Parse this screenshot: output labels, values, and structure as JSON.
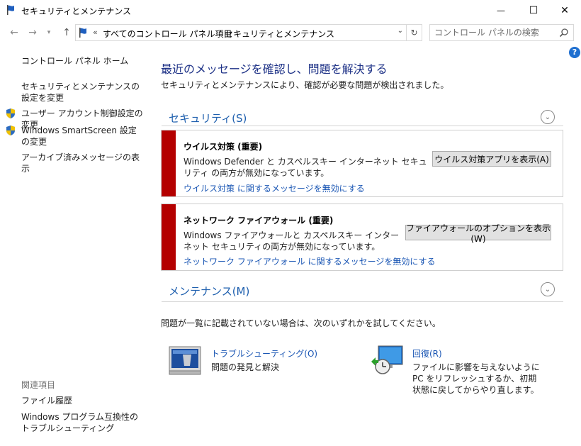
{
  "window": {
    "title": "セキュリティとメンテナンス",
    "minimize_glyph": "—",
    "maximize_glyph": "☐",
    "close_glyph": "✕"
  },
  "navigation": {
    "back_glyph": "←",
    "forward_glyph": "→",
    "recent_glyph": "▾",
    "up_glyph": "↑",
    "address_overflow": "«",
    "breadcrumbs": [
      "すべてのコントロール パネル項目",
      "セキュリティとメンテナンス"
    ],
    "separator": "›",
    "dropdown_glyph": "⌄",
    "refresh_glyph": "↻",
    "search_placeholder": "コントロール パネルの検索"
  },
  "help_glyph": "?",
  "sidebar": {
    "home": "コントロール パネル ホーム",
    "items": [
      {
        "label": "セキュリティとメンテナンスの設定を変更",
        "shield": false
      },
      {
        "label": "ユーザー アカウント制御設定の変更",
        "shield": true
      },
      {
        "label": "Windows SmartScreen 設定の変更",
        "shield": true
      },
      {
        "label": "アーカイブ済みメッセージの表示",
        "shield": false
      }
    ],
    "related_heading": "関連項目",
    "related": [
      "ファイル履歴",
      "Windows プログラム互換性のトラブルシューティング"
    ]
  },
  "main": {
    "heading": "最近のメッセージを確認し、問題を解決する",
    "subtext": "セキュリティとメンテナンスにより、確認が必要な問題が検出されました。",
    "security": {
      "title": "セキュリティ(S)",
      "alerts": [
        {
          "title": "ウイルス対策 (重要)",
          "body": "Windows Defender と カスペルスキー インターネット セキュリティ の両方が無効になっています。",
          "link": "ウイルス対策 に関するメッセージを無効にする",
          "button": "ウイルス対策アプリを表示(A)"
        },
        {
          "title": "ネットワーク ファイアウォール (重要)",
          "body": "Windows ファイアウォールと カスペルスキー インターネット セキュリティの両方が無効になっています。",
          "link": "ネットワーク ファイアウォール に関するメッセージを無効にする",
          "button": "ファイアウォールのオプションを表示(W)"
        }
      ]
    },
    "maintenance": {
      "title": "メンテナンス(M)"
    },
    "try_text": "問題が一覧に記載されていない場合は、次のいずれかを試してください。",
    "tools": [
      {
        "name": "トラブルシューティング(O)",
        "desc": "問題の発見と解決"
      },
      {
        "name": "回復(R)",
        "desc": "ファイルに影響を与えないように PC をリフレッシュするか、初期状態に戻してからやり直します。"
      }
    ]
  },
  "colors": {
    "alert_bar": "#b40000",
    "link": "#1a56b4",
    "heading": "#1e3287",
    "section_title": "#1e5fae"
  }
}
